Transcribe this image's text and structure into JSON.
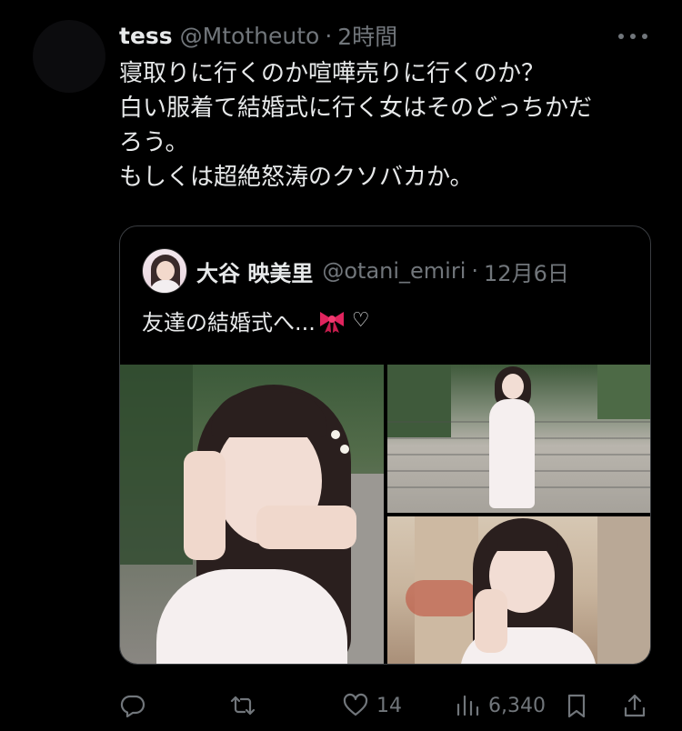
{
  "tweet": {
    "display_name": "tess",
    "handle": "@Mtotheuto",
    "separator": "·",
    "time": "2時間",
    "lines": [
      "寝取りに行くのか喧嘩売りに行くのか？",
      "白い服着て結婚式に行く女はそのどっちかだ",
      "ろう。",
      "もしくは超絶怒涛のクソバカか。"
    ]
  },
  "quote": {
    "display_name": "大谷 映美里",
    "handle": "@otani_emiri",
    "separator": "·",
    "time": "12月6日",
    "text": "友達の結婚式へ...",
    "heart": "♡",
    "emoji_icon": "ribbon-icon"
  },
  "actions": {
    "reply": {
      "icon": "reply-icon",
      "count": ""
    },
    "retweet": {
      "icon": "retweet-icon",
      "count": ""
    },
    "like": {
      "icon": "heart-icon",
      "count": "14"
    },
    "views": {
      "icon": "views-icon",
      "count": "6,340"
    },
    "bookmark": {
      "icon": "bookmark-icon",
      "count": ""
    },
    "share": {
      "icon": "share-icon",
      "count": ""
    }
  },
  "colors": {
    "background": "#000000",
    "text_primary": "#e7e9ea",
    "text_secondary": "#71767b",
    "border": "#3a3d41",
    "ribbon": "#e0245e"
  }
}
